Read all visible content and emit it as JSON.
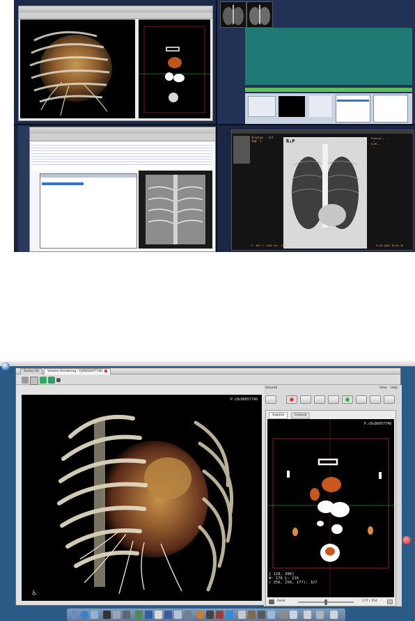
{
  "collage": {
    "volume_window": {
      "ct_overlay_top": "",
      "ct_overlay_bottom": ""
    },
    "xray_viewer": {
      "header": "display - 1/4",
      "header_sub": "Img: 1",
      "xray_marker": "R↓P",
      "right_text": [
        "Evenius , ...",
        "...",
        "B-HE...",
        "..."
      ],
      "bottom_left": "X: 362 Y: 1190 Val: 1120",
      "bottom_right": "12.04.2007 18:01:26"
    }
  },
  "app": {
    "tabs": [
      {
        "label": "Series (3)",
        "active": false
      },
      {
        "label": "Volume Rendering - FJ2N5DSYT740",
        "active": true
      }
    ],
    "vr_id": "P.c8c86057740",
    "side_menu_label": "Smooth",
    "side_corner_labels": [
      "View",
      "Help"
    ],
    "ct": {
      "subtabs": [
        {
          "label": "Sagittal",
          "active": true
        },
        {
          "label": "Coronal",
          "active": false
        }
      ],
      "id": "P.c8c86057740",
      "overlay_lines": [
        "[ 128, 306]",
        "W: 176 L: 216",
        "( 256, 256, 177): 327"
      ],
      "status_label": "Axial",
      "slice_value": "177 / 354",
      "slice_fraction": 0.5
    }
  },
  "colors": {
    "teal": "#1f7a76",
    "desktop_blue": "#2a5a86",
    "accent_red": "#d23b2b",
    "crosshair_green": "#2bd22b",
    "crosshair_red": "#d22b2b"
  },
  "icons": [
    "orb-icon",
    "mail-icon",
    "globe-icon",
    "finder-icon",
    "terminal-icon",
    "chart-icon",
    "folder-icon",
    "photo-icon",
    "music-icon",
    "calendar-icon",
    "settings-icon",
    "trash-icon"
  ]
}
